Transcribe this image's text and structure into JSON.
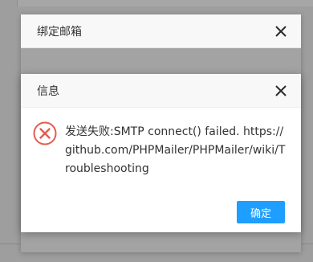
{
  "background_dialog": {
    "title": "绑定邮箱"
  },
  "dialog": {
    "title": "信息",
    "message": "发送失败:SMTP connect() failed. https://github.com/PHPMailer/PHPMailer/wiki/Troubleshooting",
    "icon": "error-icon",
    "ok_label": "确定"
  },
  "colors": {
    "accent": "#1e9fff",
    "error": "#e45c4f"
  }
}
